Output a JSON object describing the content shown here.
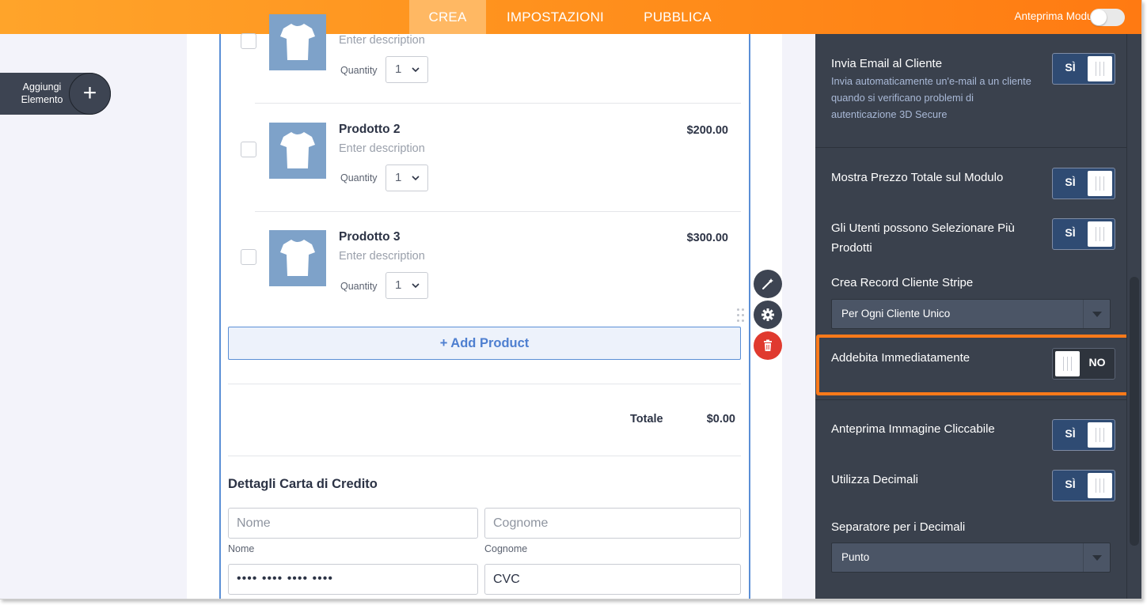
{
  "topbar": {
    "tabs": [
      {
        "label": "CREA",
        "active": true
      },
      {
        "label": "IMPOSTAZIONI",
        "active": false
      },
      {
        "label": "PUBBLICA",
        "active": false
      }
    ],
    "preview_label": "Anteprima Modulo",
    "preview_enabled": false
  },
  "left": {
    "add_element_label": "Aggiungi Elemento"
  },
  "form": {
    "products": [
      {
        "name": "",
        "description": "Enter description",
        "quantity_label": "Quantity",
        "quantity": "1",
        "price": ""
      },
      {
        "name": "Prodotto 2",
        "description": "Enter description",
        "quantity_label": "Quantity",
        "quantity": "1",
        "price": "$200.00"
      },
      {
        "name": "Prodotto 3",
        "description": "Enter description",
        "quantity_label": "Quantity",
        "quantity": "1",
        "price": "$300.00"
      }
    ],
    "add_product_label": "+ Add Product",
    "total_label": "Totale",
    "total_value": "$0.00",
    "credit_card_title": "Dettagli Carta di Credito",
    "first_name_placeholder": "Nome",
    "first_name_sublabel": "Nome",
    "last_name_placeholder": "Cognome",
    "last_name_sublabel": "Cognome",
    "card_number_value": "•••• •••• •••• ••••",
    "cvc_placeholder": "CVC"
  },
  "tools": [
    "wand-icon",
    "gear-icon",
    "trash-icon"
  ],
  "panel": {
    "email": {
      "title": "Invia Email al Cliente",
      "description": "Invia automaticamente un'e-mail a un cliente quando si verificano problemi di autenticazione 3D Secure",
      "toggle": "SÌ"
    },
    "show_total": {
      "title": "Mostra Prezzo Totale sul Modulo",
      "toggle": "SÌ"
    },
    "multi_select": {
      "title": "Gli Utenti possono Selezionare Più Prodotti",
      "toggle": "SÌ"
    },
    "stripe_record": {
      "title": "Crea Record Cliente Stripe",
      "value": "Per Ogni Cliente Unico"
    },
    "charge_now": {
      "title": "Addebita Immediatamente",
      "toggle": "NO"
    },
    "clickable_image": {
      "title": "Anteprima Immagine Cliccabile",
      "toggle": "SÌ"
    },
    "decimals": {
      "title": "Utilizza Decimali",
      "toggle": "SÌ"
    },
    "decimal_separator": {
      "title": "Separatore per i Decimali",
      "value": "Punto"
    }
  },
  "colors": {
    "accent_orange": "#ff8c1a",
    "panel_bg": "#3a414d",
    "toggle_on": "#2f4b73",
    "add_product_blue": "#4e7fd0",
    "delete_red": "#e03a2f"
  }
}
